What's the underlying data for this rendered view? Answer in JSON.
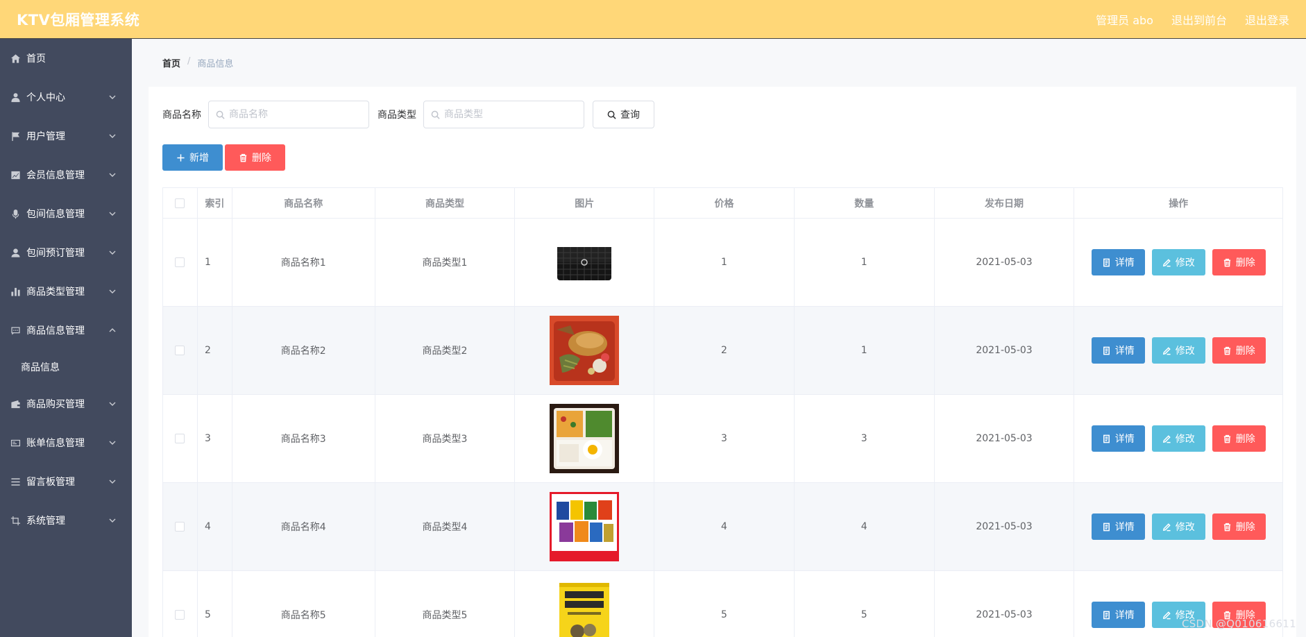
{
  "header": {
    "title": "KTV包厢管理系统",
    "admin": "管理员 abo",
    "back_to_front": "退出到前台",
    "logout": "退出登录"
  },
  "sidebar": {
    "items": [
      {
        "label": "首页",
        "icon": "home-icon",
        "expanded": false
      },
      {
        "label": "个人中心",
        "icon": "user-icon",
        "expanded": false
      },
      {
        "label": "用户管理",
        "icon": "flag-icon",
        "expanded": false
      },
      {
        "label": "会员信息管理",
        "icon": "chart-icon",
        "expanded": false
      },
      {
        "label": "包间信息管理",
        "icon": "mic-icon",
        "expanded": false
      },
      {
        "label": "包间预订管理",
        "icon": "person-icon",
        "expanded": false
      },
      {
        "label": "商品类型管理",
        "icon": "bar-icon",
        "expanded": false
      },
      {
        "label": "商品信息管理",
        "icon": "message-icon",
        "expanded": true
      },
      {
        "label": "商品购买管理",
        "icon": "wallet-icon",
        "expanded": false
      },
      {
        "label": "账单信息管理",
        "icon": "bill-icon",
        "expanded": false
      },
      {
        "label": "留言板管理",
        "icon": "list-icon",
        "expanded": false
      },
      {
        "label": "系统管理",
        "icon": "crop-icon",
        "expanded": false
      }
    ],
    "submenu": {
      "label": "商品信息"
    }
  },
  "breadcrumb": {
    "home": "首页",
    "separator": "/",
    "current": "商品信息"
  },
  "search": {
    "name_label": "商品名称",
    "name_placeholder": "商品名称",
    "type_label": "商品类型",
    "type_placeholder": "商品类型",
    "query_label": "查询"
  },
  "actions": {
    "add_label": "新增",
    "delete_label": "删除"
  },
  "table": {
    "headers": {
      "index": "索引",
      "name": "商品名称",
      "type": "商品类型",
      "image": "图片",
      "price": "价格",
      "quantity": "数量",
      "date": "发布日期",
      "ops": "操作"
    },
    "row_actions": {
      "detail": "详情",
      "edit": "修改",
      "delete": "删除"
    },
    "rows": [
      {
        "index": "1",
        "name": "商品名称1",
        "type": "商品类型1",
        "price": "1",
        "quantity": "1",
        "date": "2021-05-03",
        "image": "handbag"
      },
      {
        "index": "2",
        "name": "商品名称2",
        "type": "商品类型2",
        "price": "2",
        "quantity": "1",
        "date": "2021-05-03",
        "image": "fried-chicken-box"
      },
      {
        "index": "3",
        "name": "商品名称3",
        "type": "商品类型3",
        "price": "3",
        "quantity": "3",
        "date": "2021-05-03",
        "image": "bento-box"
      },
      {
        "index": "4",
        "name": "商品名称4",
        "type": "商品类型4",
        "price": "4",
        "quantity": "4",
        "date": "2021-05-03",
        "image": "snack-gift-pack"
      },
      {
        "index": "5",
        "name": "商品名称5",
        "type": "商品类型5",
        "price": "5",
        "quantity": "5",
        "date": "2021-05-03",
        "image": "book"
      }
    ]
  },
  "watermark": "CSDN @Q010616611",
  "colors": {
    "header_bg": "#ffd778",
    "sidebar_bg": "#424a5e",
    "primary": "#3e8ed0",
    "info": "#5bc0de",
    "danger": "#ff5a5a"
  }
}
